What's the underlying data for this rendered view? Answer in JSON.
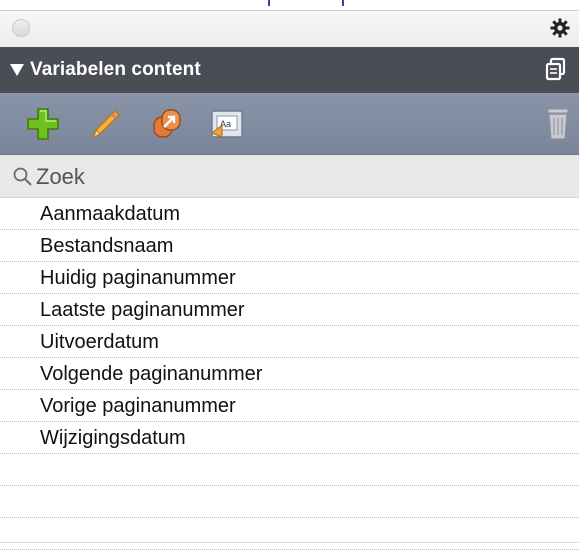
{
  "window": {
    "settings_icon": "gear-icon"
  },
  "panel": {
    "title": "Variabelen content",
    "expanded": true,
    "copy_icon": "copy-icon"
  },
  "toolbar": {
    "buttons": [
      {
        "icon": "plus-icon",
        "color": "#6fbf1e"
      },
      {
        "icon": "pencil-icon",
        "color": "#f2b13a"
      },
      {
        "icon": "convert-icon",
        "color": "#e07a3c"
      },
      {
        "icon": "text-field-icon",
        "color": "#f0a040"
      },
      {
        "icon": "trash-icon",
        "color": "#b7bbc4"
      }
    ]
  },
  "search": {
    "placeholder": "Zoek",
    "value": ""
  },
  "variables": [
    "Aanmaakdatum",
    "Bestandsnaam",
    "Huidig paginanummer",
    "Laatste paginanummer",
    "Uitvoerdatum",
    "Volgende paginanummer",
    "Vorige paginanummer",
    "Wijzigingsdatum"
  ]
}
